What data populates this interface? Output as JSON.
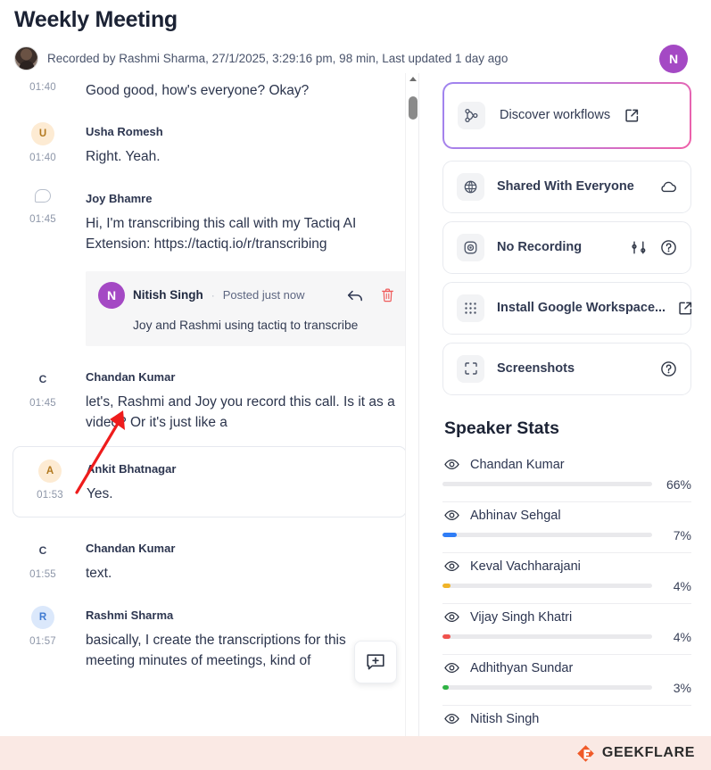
{
  "header": {
    "title": "Weekly Meeting",
    "meta": "Recorded by Rashmi Sharma, 27/1/2025, 3:29:16 pm, 98 min, Last updated 1 day ago",
    "user_initial": "N",
    "user_avatar_color": "#a449c4"
  },
  "transcript": [
    {
      "id": "t1",
      "avatar": "",
      "avatar_kind": "none",
      "speaker": "",
      "time": "01:40",
      "text": "Good good, how's everyone? Okay?"
    },
    {
      "id": "t2",
      "avatar": "U",
      "avatar_kind": "orange",
      "speaker": "Usha Romesh",
      "time": "01:40",
      "text": "Right. Yeah."
    },
    {
      "id": "t3",
      "avatar": "bubble",
      "avatar_kind": "bubble",
      "speaker": "Joy Bhamre",
      "time": "01:45",
      "text": "Hi, I'm transcribing this call with my Tactiq AI Extension: https://tactiq.io/r/transcribing"
    },
    {
      "id": "t4",
      "avatar": "C",
      "avatar_kind": "plain",
      "speaker": "Chandan Kumar",
      "time": "01:45",
      "text": "let's, Rashmi and Joy you record this call. Is it as a video? Or it's just like a"
    },
    {
      "id": "t5",
      "avatar": "A",
      "avatar_kind": "orange",
      "speaker": "Ankit Bhatnagar",
      "time": "01:53",
      "text": "Yes.",
      "card": true
    },
    {
      "id": "t6",
      "avatar": "C",
      "avatar_kind": "plain",
      "speaker": "Chandan Kumar",
      "time": "01:55",
      "text": "text."
    },
    {
      "id": "t7",
      "avatar": "R",
      "avatar_kind": "blue",
      "speaker": "Rashmi Sharma",
      "time": "01:57",
      "text": "basically, I create the transcriptions for this meeting minutes of meetings, kind of"
    }
  ],
  "comment": {
    "author": "Nitish Singh",
    "separator": "·",
    "posted": "Posted just now",
    "text": "Joy and Rashmi using tactiq to transcribe",
    "avatar_initial": "N",
    "avatar_color": "#a449c4",
    "reply_icon": "reply-arrow-icon",
    "delete_icon": "trash-icon",
    "delete_color": "#ef5a5a"
  },
  "fab": {
    "icon": "add-comment-icon"
  },
  "scrollbar": {
    "arrow_icon": "scroll-up-arrow-icon"
  },
  "sidebar": {
    "cards": [
      {
        "id": "discover",
        "label": "Discover workflows",
        "icon": "workflow-branch-icon",
        "highlight": true,
        "right_icons": [],
        "inline_icon": "external-link-icon"
      },
      {
        "id": "shared",
        "label": "Shared With Everyone",
        "icon": "globe-icon",
        "highlight": false,
        "right_icons": [
          "cloud-icon"
        ]
      },
      {
        "id": "recording",
        "label": "No Recording",
        "icon": "record-camera-icon",
        "highlight": false,
        "right_icons": [
          "settings-sliders-icon",
          "help-circle-icon"
        ]
      },
      {
        "id": "workspace",
        "label": "Install Google Workspace...",
        "icon": "grid-dots-icon",
        "highlight": false,
        "right_icons": [
          "external-link-icon"
        ]
      },
      {
        "id": "screenshots",
        "label": "Screenshots",
        "icon": "crop-frame-icon",
        "highlight": false,
        "right_icons": [
          "help-circle-icon"
        ]
      }
    ],
    "stats_title": "Speaker Stats",
    "speakers": [
      {
        "name": "Chandan Kumar",
        "pct": 66,
        "pct_label": "66%",
        "color": "#e9e9ec",
        "eye_icon": "eye-icon"
      },
      {
        "name": "Abhinav Sehgal",
        "pct": 7,
        "pct_label": "7%",
        "color": "#2f7df6",
        "eye_icon": "eye-icon"
      },
      {
        "name": "Keval Vachharajani",
        "pct": 4,
        "pct_label": "4%",
        "color": "#f0b429",
        "eye_icon": "eye-icon"
      },
      {
        "name": "Vijay Singh Khatri",
        "pct": 4,
        "pct_label": "4%",
        "color": "#f0524d",
        "eye_icon": "eye-icon"
      },
      {
        "name": "Adhithyan Sundar",
        "pct": 3,
        "pct_label": "3%",
        "color": "#2fb344",
        "eye_icon": "eye-icon"
      },
      {
        "name": "Nitish Singh",
        "pct": 0,
        "pct_label": "",
        "color": "#e9e9ec",
        "eye_icon": "eye-icon"
      }
    ]
  },
  "footer": {
    "brand": "GEEKFLARE",
    "brand_color": "#f05a28",
    "background": "#fae9e4"
  }
}
